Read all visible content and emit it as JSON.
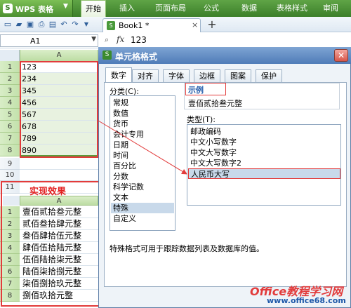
{
  "app": {
    "title": "WPS 表格"
  },
  "menu": [
    "开始",
    "插入",
    "页面布局",
    "公式",
    "数据",
    "表格样式",
    "审阅"
  ],
  "doc_tab": {
    "name": "Book1 *"
  },
  "formula_bar": {
    "name_box": "A1",
    "value": "123"
  },
  "sheet": {
    "col_a": "A",
    "rows_top": [
      {
        "num": "1",
        "value": "123"
      },
      {
        "num": "2",
        "value": "234"
      },
      {
        "num": "3",
        "value": "345"
      },
      {
        "num": "4",
        "value": "456"
      },
      {
        "num": "5",
        "value": "567"
      },
      {
        "num": "6",
        "value": "678"
      },
      {
        "num": "7",
        "value": "789"
      },
      {
        "num": "8",
        "value": "890"
      }
    ],
    "row9": "9",
    "row10": "10",
    "row11": "11",
    "effect_label": "实现效果",
    "col_a2": "A",
    "rows_bottom": [
      {
        "num": "1",
        "value": "壹佰贰拾叁元整"
      },
      {
        "num": "2",
        "value": "贰佰叁拾肆元整"
      },
      {
        "num": "3",
        "value": "叁佰肆拾伍元整"
      },
      {
        "num": "4",
        "value": "肆佰伍拾陆元整"
      },
      {
        "num": "5",
        "value": "伍佰陆拾柒元整"
      },
      {
        "num": "6",
        "value": "陆佰柒拾捌元整"
      },
      {
        "num": "7",
        "value": "柒佰捌拾玖元整"
      },
      {
        "num": "8",
        "value": "捌佰玖拾元整"
      }
    ]
  },
  "dialog": {
    "title": "单元格格式",
    "tabs": [
      "数字",
      "对齐",
      "字体",
      "边框",
      "图案",
      "保护"
    ],
    "category_label": "分类(C):",
    "categories": [
      "常规",
      "数值",
      "货币",
      "会计专用",
      "日期",
      "时间",
      "百分比",
      "分数",
      "科学记数",
      "文本",
      "特殊",
      "自定义"
    ],
    "selected_category": "特殊",
    "sample_label": "示例",
    "sample_value": "壹佰贰拾叁元整",
    "type_label": "类型(T):",
    "types": [
      "邮政编码",
      "中文小写数字",
      "中文大写数字",
      "中文大写数字2",
      "人民币大写"
    ],
    "selected_type": "人民币大写",
    "description": "特殊格式可用于跟踪数据列表及数据库的值。"
  },
  "watermark": {
    "line1": "Office教程学习网",
    "line2": "www.office68.com"
  },
  "colors": {
    "menu_green": "#3c7f2a",
    "highlight_red": "#e23b3b",
    "dialog_blue": "#4f7cb8"
  }
}
